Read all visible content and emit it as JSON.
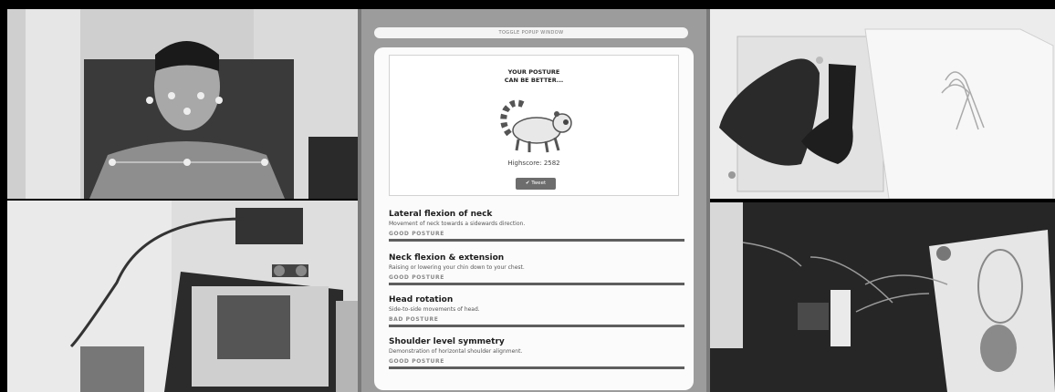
{
  "toggle_label": "TOGGLE POPUP WINDOW",
  "result": {
    "title": "YOUR POSTURE\nCAN BE BETTER...",
    "highscore": "Highscore: 2582",
    "tweet_label": "✔ Tweet",
    "illustration_icon": "lemur-icon"
  },
  "metrics": [
    {
      "title": "Lateral flexion of neck",
      "description": "Movement of neck towards a sidewards direction.",
      "status": "GOOD POSTURE"
    },
    {
      "title": "Neck flexion & extension",
      "description": "Raising or lowering your chin down to your chest.",
      "status": "GOOD POSTURE"
    },
    {
      "title": "Head rotation",
      "description": "Side-to-side movements of head.",
      "status": "BAD POSTURE"
    },
    {
      "title": "Shoulder level symmetry",
      "description": "Demonstration of horizontal shoulder alignment.",
      "status": "GOOD POSTURE"
    }
  ],
  "colors": {
    "card": "#fbfbfb",
    "panel": "#9c9c9c",
    "bar": "#5e5e5e"
  }
}
